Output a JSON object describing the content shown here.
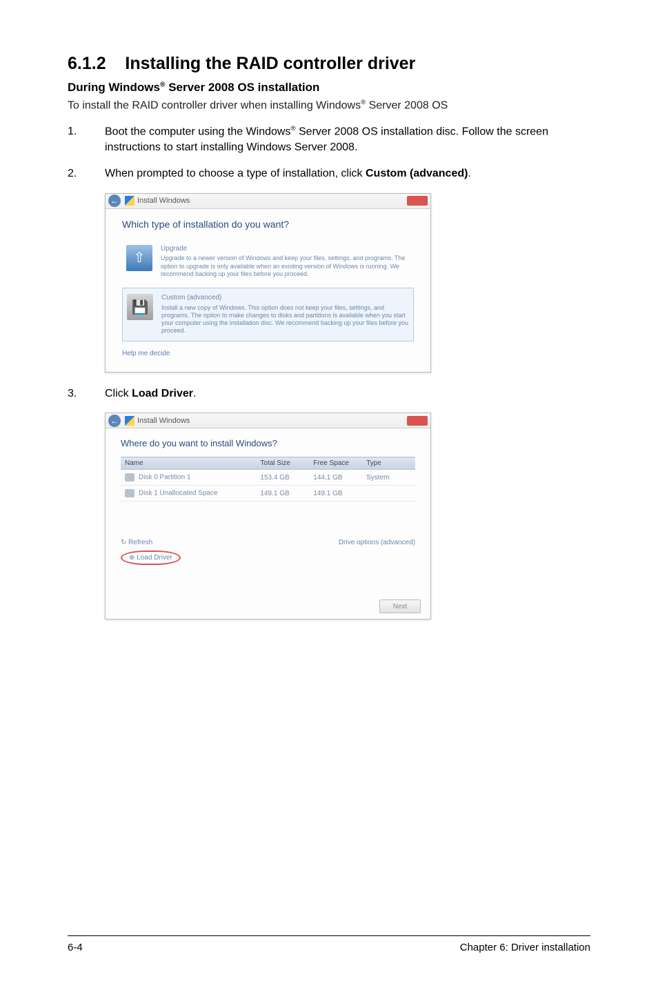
{
  "heading": {
    "number": "6.1.2",
    "title": "Installing the RAID controller driver"
  },
  "subheading": {
    "prefix": "During Windows",
    "reg": "®",
    "suffix": " Server 2008 OS installation"
  },
  "intro": {
    "prefix": "To install the RAID controller driver when installing Windows",
    "reg": "®",
    "suffix": " Server 2008 OS"
  },
  "steps": {
    "s1": {
      "num": "1.",
      "t1": "Boot the computer using the Windows",
      "reg": "®",
      "t2": " Server 2008 OS installation disc. Follow the screen instructions to start installing Windows Server 2008."
    },
    "s2": {
      "num": "2.",
      "t1": "When prompted to choose a type of installation, click ",
      "bold": "Custom (advanced)",
      "t2": "."
    },
    "s3": {
      "num": "3.",
      "t1": "Click ",
      "bold": "Load Driver",
      "t2": "."
    }
  },
  "dialog1": {
    "title": "Install Windows",
    "heading": "Which type of installation do you want?",
    "upgrade": {
      "title": "Upgrade",
      "desc": "Upgrade to a newer version of Windows and keep your files, settings, and programs. The option to upgrade is only available when an existing version of Windows is running. We recommend backing up your files before you proceed."
    },
    "custom": {
      "title": "Custom (advanced)",
      "desc": "Install a new copy of Windows. This option does not keep your files, settings, and programs. The option to make changes to disks and partitions is available when you start your computer using the installation disc. We recommend backing up your files before you proceed."
    },
    "help": "Help me decide"
  },
  "dialog2": {
    "title": "Install Windows",
    "heading": "Where do you want to install Windows?",
    "cols": {
      "c1": "Name",
      "c2": "Total Size",
      "c3": "Free Space",
      "c4": "Type"
    },
    "rows": [
      {
        "name": "Disk 0 Partition 1",
        "size": "153.4 GB",
        "free": "144.1 GB",
        "type": "System"
      },
      {
        "name": "Disk 1 Unallocated Space",
        "size": "149.1 GB",
        "free": "149.1 GB",
        "type": ""
      }
    ],
    "refresh": "Refresh",
    "load": "Load Driver",
    "drive": "Drive options (advanced)",
    "next": "Next"
  },
  "footer": {
    "left": "6-4",
    "right": "Chapter 6: Driver installation"
  }
}
